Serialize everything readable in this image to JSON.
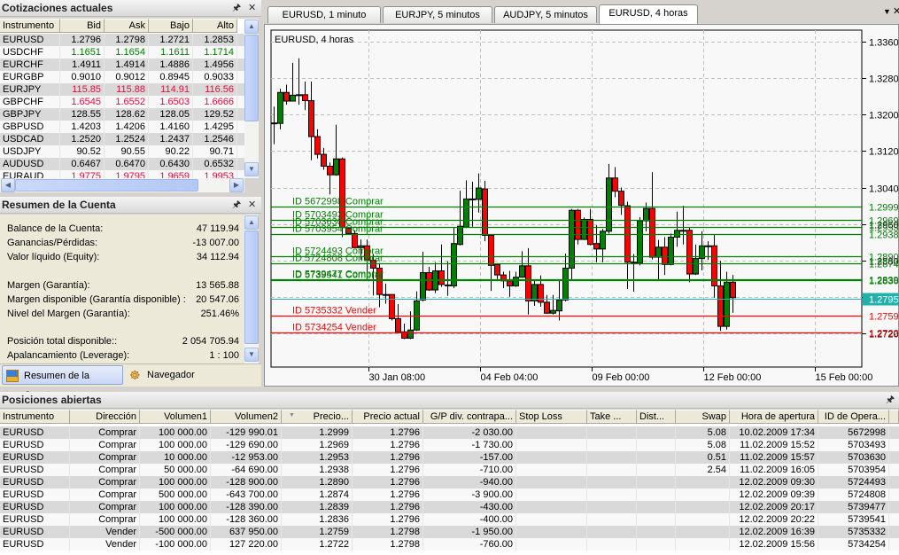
{
  "quotes": {
    "title": "Cotizaciones actuales",
    "columns": [
      "Instrumento",
      "Bid",
      "Ask",
      "Bajo",
      "Alto"
    ],
    "rows": [
      {
        "sym": "EURUSD",
        "bid": "1.2796",
        "ask": "1.2798",
        "low": "1.2721",
        "high": "1.2853",
        "color": "black"
      },
      {
        "sym": "USDCHF",
        "bid": "1.1651",
        "ask": "1.1654",
        "low": "1.1611",
        "high": "1.1714",
        "color": "green"
      },
      {
        "sym": "EURCHF",
        "bid": "1.4911",
        "ask": "1.4914",
        "low": "1.4886",
        "high": "1.4956",
        "color": "black"
      },
      {
        "sym": "EURGBP",
        "bid": "0.9010",
        "ask": "0.9012",
        "low": "0.8945",
        "high": "0.9033",
        "color": "black"
      },
      {
        "sym": "EURJPY",
        "bid": "115.85",
        "ask": "115.88",
        "low": "114.91",
        "high": "116.56",
        "color": "red"
      },
      {
        "sym": "GBPCHF",
        "bid": "1.6545",
        "ask": "1.6552",
        "low": "1.6503",
        "high": "1.6666",
        "color": "red"
      },
      {
        "sym": "GBPJPY",
        "bid": "128.55",
        "ask": "128.62",
        "low": "128.05",
        "high": "129.52",
        "color": "black"
      },
      {
        "sym": "GBPUSD",
        "bid": "1.4203",
        "ask": "1.4206",
        "low": "1.4160",
        "high": "1.4295",
        "color": "black"
      },
      {
        "sym": "USDCAD",
        "bid": "1.2520",
        "ask": "1.2524",
        "low": "1.2437",
        "high": "1.2546",
        "color": "black"
      },
      {
        "sym": "USDJPY",
        "bid": "90.52",
        "ask": "90.55",
        "low": "90.22",
        "high": "90.71",
        "color": "black"
      },
      {
        "sym": "AUDUSD",
        "bid": "0.6467",
        "ask": "0.6470",
        "low": "0.6430",
        "high": "0.6532",
        "color": "black"
      },
      {
        "sym": "EURAUD",
        "bid": "1.9775",
        "ask": "1.9795",
        "low": "1.9659",
        "high": "1.9953",
        "color": "red"
      }
    ]
  },
  "account": {
    "title": "Resumen de la Cuenta",
    "lines": [
      {
        "label": "Balance de la Cuenta:",
        "value": "47 119.94"
      },
      {
        "label": "Ganancias/Pérdidas:",
        "value": "-13 007.00"
      },
      {
        "label": "Valor líquido (Equity):",
        "value": "34 112.94"
      },
      {
        "label": "Margen (Garantía):",
        "value": "13 565.88"
      },
      {
        "label": "Margen disponible (Garantía disponible) :",
        "value": "20 547.06"
      },
      {
        "label": "Nivel del Margen (Garantía):",
        "value": "251.46%"
      },
      {
        "label": "Posición total disponible::",
        "value": "2 054 705.94"
      },
      {
        "label": "Apalancamiento (Leverage):",
        "value": "1 : 100"
      }
    ],
    "tabs": [
      "Resumen de la Cuenta",
      "Navegador"
    ]
  },
  "chart_tabs": [
    "EURUSD, 1 minuto",
    "EURJPY, 5 minutos",
    "AUDJPY, 5 minutos",
    "EURUSD, 4 horas"
  ],
  "chart_data": {
    "type": "candlestick",
    "title": "EURUSD, 4 horas",
    "ylim": [
      1.2652,
      1.3384
    ],
    "y_ticks": [
      "1.3360",
      "1.3280",
      "1.3200",
      "1.3120",
      "1.3040",
      "1.2960",
      "1.2880",
      "1.2800",
      "1.2720"
    ],
    "x_ticks": [
      {
        "label": "30 Jan 08:00",
        "index": 15.5
      },
      {
        "label": "04 Feb 04:00",
        "index": 33.5
      },
      {
        "label": "09 Feb 00:00",
        "index": 51.5
      },
      {
        "label": "12 Feb 00:00",
        "index": 69.5
      },
      {
        "label": "15 Feb 00:00",
        "index": 87.5
      }
    ],
    "bid": {
      "price": 1.2795,
      "label": "1.2795"
    },
    "ohlc": [
      [
        1.3182,
        1.3218,
        1.3135,
        1.3182
      ],
      [
        1.3181,
        1.3257,
        1.3168,
        1.3249
      ],
      [
        1.3249,
        1.3266,
        1.3222,
        1.323
      ],
      [
        1.323,
        1.3314,
        1.323,
        1.3243
      ],
      [
        1.3243,
        1.3324,
        1.3222,
        1.3244
      ],
      [
        1.3244,
        1.3273,
        1.321,
        1.3231
      ],
      [
        1.3231,
        1.3273,
        1.31,
        1.3152
      ],
      [
        1.3152,
        1.3168,
        1.3104,
        1.3113
      ],
      [
        1.3113,
        1.3127,
        1.3079,
        1.3087
      ],
      [
        1.3087,
        1.3095,
        1.3025,
        1.3068
      ],
      [
        1.3068,
        1.3178,
        1.3066,
        1.3103
      ],
      [
        1.3103,
        1.3106,
        1.2931,
        1.2952
      ],
      [
        1.2951,
        1.2952,
        1.2936,
        1.2939
      ],
      [
        1.2939,
        1.2946,
        1.2907,
        1.2908
      ],
      [
        1.2908,
        1.2926,
        1.2881,
        1.2912
      ],
      [
        1.2912,
        1.2926,
        1.2835,
        1.2881
      ],
      [
        1.288,
        1.2894,
        1.2803,
        1.2863
      ],
      [
        1.2863,
        1.2874,
        1.2777,
        1.2805
      ],
      [
        1.2805,
        1.2829,
        1.2785,
        1.2805
      ],
      [
        1.2805,
        1.2805,
        1.2748,
        1.2752
      ],
      [
        1.2752,
        1.2784,
        1.2722,
        1.2723
      ],
      [
        1.2723,
        1.2741,
        1.2707,
        1.2709
      ],
      [
        1.2709,
        1.2768,
        1.2707,
        1.2727
      ],
      [
        1.2727,
        1.2812,
        1.2725,
        1.2791
      ],
      [
        1.2793,
        1.2899,
        1.279,
        1.2853
      ],
      [
        1.2853,
        1.2866,
        1.2813,
        1.2815
      ],
      [
        1.2815,
        1.2876,
        1.2808,
        1.2857
      ],
      [
        1.2857,
        1.2915,
        1.2822,
        1.2827
      ],
      [
        1.2826,
        1.2878,
        1.2802,
        1.2826
      ],
      [
        1.2824,
        1.2952,
        1.2819,
        1.2917
      ],
      [
        1.2915,
        1.3033,
        1.2913,
        1.2955
      ],
      [
        1.2953,
        1.3056,
        1.2951,
        1.3015
      ],
      [
        1.3015,
        1.3053,
        1.2954,
        1.3015
      ],
      [
        1.3014,
        1.3071,
        1.2985,
        1.3039
      ],
      [
        1.3037,
        1.3055,
        1.2922,
        1.2935
      ],
      [
        1.2935,
        1.2935,
        1.2813,
        1.2869
      ],
      [
        1.2871,
        1.2871,
        1.2839,
        1.2848
      ],
      [
        1.2848,
        1.2855,
        1.2819,
        1.2835
      ],
      [
        1.2835,
        1.2857,
        1.28,
        1.2824
      ],
      [
        1.2824,
        1.2855,
        1.2822,
        1.2843
      ],
      [
        1.2843,
        1.29,
        1.2842,
        1.2868
      ],
      [
        1.2868,
        1.2907,
        1.2761,
        1.2791
      ],
      [
        1.2791,
        1.2837,
        1.278,
        1.2827
      ],
      [
        1.2827,
        1.2847,
        1.2778,
        1.2788
      ],
      [
        1.2788,
        1.2804,
        1.2763,
        1.2764
      ],
      [
        1.2764,
        1.2804,
        1.2761,
        1.277
      ],
      [
        1.2769,
        1.2837,
        1.2748,
        1.2793
      ],
      [
        1.2793,
        1.2895,
        1.279,
        1.2863
      ],
      [
        1.2863,
        1.2993,
        1.2837,
        1.299
      ],
      [
        1.299,
        1.2993,
        1.2915,
        1.2926
      ],
      [
        1.2926,
        1.2974,
        1.2925,
        1.297
      ],
      [
        1.297,
        1.2993,
        1.2913,
        1.2915
      ],
      [
        1.2917,
        1.2957,
        1.2876,
        1.2905
      ],
      [
        1.2905,
        1.2949,
        1.2876,
        1.2944
      ],
      [
        1.2944,
        1.3092,
        1.2939,
        1.3061
      ],
      [
        1.3061,
        1.3085,
        1.3019,
        1.3032
      ],
      [
        1.3032,
        1.304,
        1.298,
        1.3001
      ],
      [
        1.3,
        1.3009,
        1.2817,
        1.2876
      ],
      [
        1.2876,
        1.2894,
        1.2811,
        1.2876
      ],
      [
        1.2874,
        1.2975,
        1.2869,
        1.2967
      ],
      [
        1.2967,
        1.3007,
        1.2944,
        1.2994
      ],
      [
        1.2994,
        1.3074,
        1.2882,
        1.2887
      ],
      [
        1.2887,
        1.2925,
        1.2837,
        1.2909
      ],
      [
        1.2909,
        1.2931,
        1.2848,
        1.2871
      ],
      [
        1.2871,
        1.2939,
        1.2869,
        1.2931
      ],
      [
        1.2931,
        1.2987,
        1.291,
        1.2946
      ],
      [
        1.2946,
        1.3,
        1.2915,
        1.2946
      ],
      [
        1.2946,
        1.2952,
        1.2832,
        1.285
      ],
      [
        1.285,
        1.2915,
        1.2848,
        1.2884
      ],
      [
        1.2884,
        1.2944,
        1.2858,
        1.2912
      ],
      [
        1.2912,
        1.2922,
        1.2881,
        1.2912
      ],
      [
        1.2912,
        1.2936,
        1.2798,
        1.2824
      ],
      [
        1.2824,
        1.2879,
        1.2725,
        1.2735
      ],
      [
        1.2735,
        1.2855,
        1.2728,
        1.2832
      ],
      [
        1.2832,
        1.2848,
        1.2765,
        1.2798
      ]
    ],
    "order_lines": [
      {
        "label": "ID 5672998 Comprar",
        "price": 1.2999,
        "axis": "1.2999",
        "side": "buy"
      },
      {
        "label": "ID 5703493 Comprar",
        "price": 1.2969,
        "axis": "1.2969",
        "side": "buy"
      },
      {
        "label": "ID 5703630 Comprar",
        "price": 1.2953,
        "axis": "1.2953",
        "side": "buy"
      },
      {
        "label": "ID 5703954 Comprar",
        "price": 1.2938,
        "axis": "1.2938",
        "side": "buy"
      },
      {
        "label": "ID 5724493 Comprar",
        "price": 1.289,
        "axis": "1.2890",
        "side": "buy"
      },
      {
        "label": "ID 5724808 Comprar",
        "price": 1.2874,
        "axis": "1.2874",
        "side": "buy"
      },
      {
        "label": "ID 5739477 Comprar",
        "price": 1.2839,
        "axis": "1.2839",
        "side": "buy"
      },
      {
        "label": "ID 5739541 Comprar",
        "price": 1.2836,
        "axis": "1.2836",
        "side": "buy"
      },
      {
        "label": "ID 5735332 Vender",
        "price": 1.2759,
        "axis": "1.2759",
        "side": "sell"
      },
      {
        "label": "ID 5734254 Vender",
        "price": 1.2722,
        "axis": "1.2722",
        "side": "sell"
      }
    ],
    "colors": {
      "up": "#008000",
      "down": "#ff0000",
      "buy": "#008000",
      "sell": "#ff0000",
      "bid": "#20b2aa"
    }
  },
  "positions": {
    "title": "Posiciones abiertas",
    "columns": [
      "Instrumento",
      "Dirección",
      "Volumen1",
      "Volumen2",
      "Precio...",
      "Precio actual",
      "G/P div. contrapa...",
      "Stop Loss",
      "Take ...",
      "Dist...",
      "Swap",
      "Hora de apertura",
      "ID de Opera..."
    ],
    "rows": [
      [
        "EURUSD",
        "Comprar",
        "100 000.00",
        "-129 990.01",
        "1.2999",
        "1.2796",
        "-2 030.00",
        "",
        "",
        "",
        "5.08",
        "10.02.2009 17:34",
        "5672998"
      ],
      [
        "EURUSD",
        "Comprar",
        "100 000.00",
        "-129 690.00",
        "1.2969",
        "1.2796",
        "-1 730.00",
        "",
        "",
        "",
        "5.08",
        "11.02.2009 15:52",
        "5703493"
      ],
      [
        "EURUSD",
        "Comprar",
        "10 000.00",
        "-12 953.00",
        "1.2953",
        "1.2796",
        "-157.00",
        "",
        "",
        "",
        "0.51",
        "11.02.2009 15:57",
        "5703630"
      ],
      [
        "EURUSD",
        "Comprar",
        "50 000.00",
        "-64 690.00",
        "1.2938",
        "1.2796",
        "-710.00",
        "",
        "",
        "",
        "2.54",
        "11.02.2009 16:05",
        "5703954"
      ],
      [
        "EURUSD",
        "Comprar",
        "100 000.00",
        "-128 900.00",
        "1.2890",
        "1.2796",
        "-940.00",
        "",
        "",
        "",
        "",
        "12.02.2009 09:30",
        "5724493"
      ],
      [
        "EURUSD",
        "Comprar",
        "500 000.00",
        "-643 700.00",
        "1.2874",
        "1.2796",
        "-3 900.00",
        "",
        "",
        "",
        "",
        "12.02.2009 09:39",
        "5724808"
      ],
      [
        "EURUSD",
        "Comprar",
        "100 000.00",
        "-128 390.00",
        "1.2839",
        "1.2796",
        "-430.00",
        "",
        "",
        "",
        "",
        "12.02.2009 20:17",
        "5739477"
      ],
      [
        "EURUSD",
        "Comprar",
        "100 000.00",
        "-128 360.00",
        "1.2836",
        "1.2796",
        "-400.00",
        "",
        "",
        "",
        "",
        "12.02.2009 20:22",
        "5739541"
      ],
      [
        "EURUSD",
        "Vender",
        "-500 000.00",
        "637 950.00",
        "1.2759",
        "1.2798",
        "-1 950.00",
        "",
        "",
        "",
        "",
        "12.02.2009 16:39",
        "5735332"
      ],
      [
        "EURUSD",
        "Vender",
        "-100 000.00",
        "127 220.00",
        "1.2722",
        "1.2798",
        "-760.00",
        "",
        "",
        "",
        "",
        "12.02.2009 15:56",
        "5734254"
      ]
    ]
  }
}
